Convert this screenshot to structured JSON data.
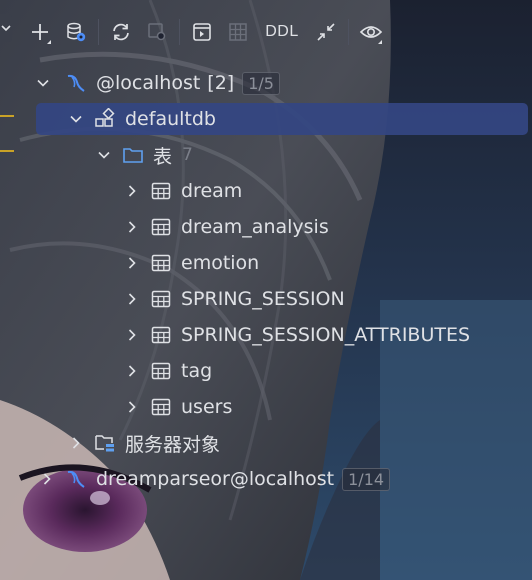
{
  "toolbar": {
    "buttons": [
      {
        "icon": "plus-icon",
        "has_menu": true
      },
      {
        "icon": "data-source-properties-icon",
        "has_menu": false
      },
      {
        "icon": "refresh-icon",
        "has_menu": false
      },
      {
        "icon": "stop-icon",
        "has_menu": false
      },
      {
        "icon": "jump-to-console-icon",
        "has_menu": false
      },
      {
        "icon": "table-view-icon",
        "has_menu": false
      },
      {
        "icon": "collapse-icon",
        "has_menu": false
      },
      {
        "icon": "eye-icon",
        "has_menu": true
      }
    ],
    "ddl_label": "DDL"
  },
  "tree": {
    "root": {
      "label": "@localhost",
      "count": "[2]",
      "badge": "1/5",
      "icon": "database-connection-icon",
      "expanded": true
    },
    "schema": {
      "label": "defaultdb",
      "icon": "schema-icon",
      "expanded": true,
      "selected": true
    },
    "tables_folder": {
      "label": "表",
      "count": "7",
      "icon": "folder-icon",
      "expanded": true
    },
    "tables": [
      {
        "label": "dream"
      },
      {
        "label": "dream_analysis"
      },
      {
        "label": "emotion"
      },
      {
        "label": "SPRING_SESSION"
      },
      {
        "label": "SPRING_SESSION_ATTRIBUTES"
      },
      {
        "label": "tag"
      },
      {
        "label": "users"
      }
    ],
    "server_objects": {
      "label": "服务器对象",
      "icon": "server-folder-icon",
      "expanded": false
    },
    "second_connection": {
      "label": "dreamparseor@localhost",
      "badge": "1/14",
      "icon": "database-connection-icon",
      "expanded": false
    }
  },
  "colors": {
    "selection": "#344682",
    "text": "#dfe1e5",
    "muted": "#8c909a",
    "connection_icon": "#4d8df6",
    "folder_icon": "#5fa0f0"
  }
}
